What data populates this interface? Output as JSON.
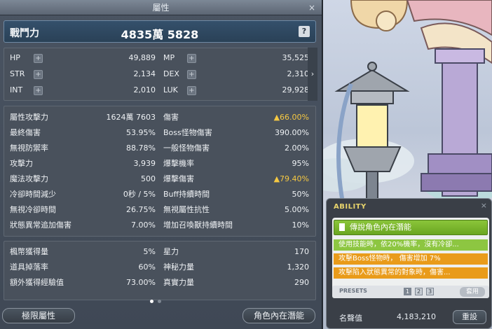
{
  "window": {
    "title": "屬性",
    "close": "×"
  },
  "combat": {
    "label": "戰鬥力",
    "value": "4835萬 5828",
    "help": "?"
  },
  "basic": [
    {
      "label": "HP",
      "value": "49,889"
    },
    {
      "label": "MP",
      "value": "35,525"
    },
    {
      "label": "STR",
      "value": "2,134"
    },
    {
      "label": "DEX",
      "value": "2,310"
    },
    {
      "label": "INT",
      "value": "2,010"
    },
    {
      "label": "LUK",
      "value": "29,928"
    }
  ],
  "expand_arrow": "›",
  "detail": [
    {
      "label": "屬性攻擊力",
      "value": "1624萬 7603"
    },
    {
      "label": "傷害",
      "value": "▲66.00%"
    },
    {
      "label": "最終傷害",
      "value": "53.95%"
    },
    {
      "label": "Boss怪物傷害",
      "value": "390.00%"
    },
    {
      "label": "無視防禦率",
      "value": "88.78%"
    },
    {
      "label": "一般怪物傷害",
      "value": "2.00%"
    },
    {
      "label": "攻擊力",
      "value": "3,939"
    },
    {
      "label": "爆擊機率",
      "value": "95%"
    },
    {
      "label": "魔法攻擊力",
      "value": "500"
    },
    {
      "label": "爆擊傷害",
      "value": "▲79.40%"
    },
    {
      "label": "冷卻時間減少",
      "value": "0秒 / 5%"
    },
    {
      "label": "Buff持續時間",
      "value": "50%"
    },
    {
      "label": "無視冷卻時間",
      "value": "26.75%"
    },
    {
      "label": "無視屬性抗性",
      "value": "5.00%"
    },
    {
      "label": "狀態異常追加傷害",
      "value": "7.00%"
    },
    {
      "label": "增加召喚獸持續時間",
      "value": "10%"
    }
  ],
  "extra": [
    {
      "label": "楓幣獲得量",
      "value": "5%"
    },
    {
      "label": "星力",
      "value": "170"
    },
    {
      "label": "道具掉落率",
      "value": "60%"
    },
    {
      "label": "神秘力量",
      "value": "1,320"
    },
    {
      "label": "額外獲得經驗值",
      "value": "73.00%"
    },
    {
      "label": "真實力量",
      "value": "290"
    }
  ],
  "buttons": {
    "hyper": "極限屬性",
    "inner": "角色內在潛能"
  },
  "ability": {
    "title": "ABILITY",
    "close": "×",
    "grade": "傳說角色內在潛能",
    "lines": [
      "使用技能時，依20%機率，沒有冷卻...",
      "攻擊Boss怪物時， 傷害增加 7%",
      "攻擊陷入狀態異常的對象時，傷害..."
    ],
    "presets_label": "PRESETS",
    "presets": [
      "1",
      "2",
      "3"
    ],
    "apply": "套用",
    "honor_label": "名聲值",
    "honor_value": "4,183,210",
    "reset": "重設"
  },
  "colors": {
    "increase": "#f5c842",
    "grade_legend": "#8bc53a",
    "line_green": "#8dc641",
    "line_orange": "#e99b1a"
  }
}
